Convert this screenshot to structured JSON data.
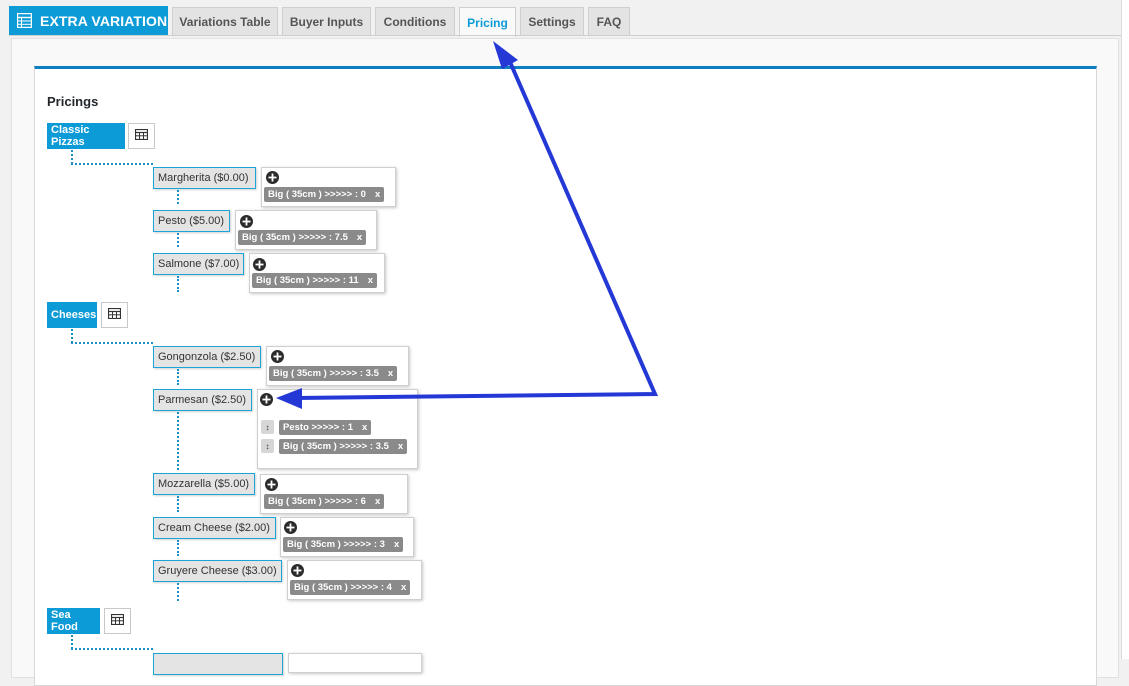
{
  "header": {
    "brand": "EXTRA VARIATION",
    "brand_icon": "list-table-icon",
    "tabs": [
      {
        "label": "Variations Table"
      },
      {
        "label": "Buyer Inputs"
      },
      {
        "label": "Conditions"
      },
      {
        "label": "Pricing",
        "active": true
      },
      {
        "label": "Settings"
      },
      {
        "label": "FAQ"
      }
    ]
  },
  "page": {
    "title": "Pricings"
  },
  "groups": [
    {
      "label": "Classic Pizzas",
      "items": [
        {
          "label": "Margherita ($0.00)",
          "rules": [
            {
              "text": "Big ( 35cm ) >>>>> : 0",
              "remove": "x"
            }
          ]
        },
        {
          "label": "Pesto ($5.00)",
          "rules": [
            {
              "text": "Big ( 35cm ) >>>>> : 7.5",
              "remove": "x"
            }
          ]
        },
        {
          "label": "Salmone ($7.00)",
          "rules": [
            {
              "text": "Big ( 35cm ) >>>>> : 11",
              "remove": "x"
            }
          ]
        }
      ]
    },
    {
      "label": "Cheeses",
      "items": [
        {
          "label": "Gongonzola ($2.50)",
          "rules": [
            {
              "text": "Big ( 35cm ) >>>>> : 3.5",
              "remove": "x"
            }
          ]
        },
        {
          "label": "Parmesan ($2.50)",
          "rules": [
            {
              "text": "Pesto >>>>> : 1",
              "remove": "x",
              "handle": "↕"
            },
            {
              "text": "Big ( 35cm ) >>>>> : 3.5",
              "remove": "x",
              "handle": "↕"
            }
          ]
        },
        {
          "label": "Mozzarella ($5.00)",
          "rules": [
            {
              "text": "Big ( 35cm ) >>>>> : 6",
              "remove": "x"
            }
          ]
        },
        {
          "label": "Cream Cheese ($2.00)",
          "rules": [
            {
              "text": "Big ( 35cm ) >>>>> : 3",
              "remove": "x"
            }
          ]
        },
        {
          "label": "Gruyere Cheese ($3.00)",
          "rules": [
            {
              "text": "Big ( 35cm ) >>>>> : 4",
              "remove": "x"
            }
          ]
        }
      ]
    },
    {
      "label": "Sea Food",
      "items": []
    }
  ],
  "colors": {
    "accent": "#0d9bd8",
    "annotation_arrow": "#2438d6",
    "chip": "#8a8a8a"
  }
}
